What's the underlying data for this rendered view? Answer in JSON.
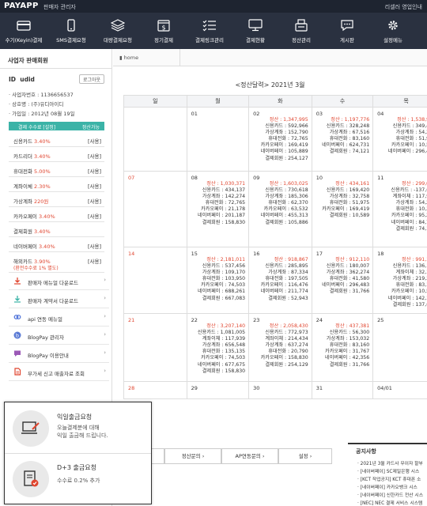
{
  "topbar": {
    "logo": "PAYAPP",
    "admin_label": "판매자 관리자",
    "right_link": "리셀러 영업인내"
  },
  "menu": [
    {
      "label": "수기(Keyin)결제",
      "icon": "card-icon"
    },
    {
      "label": "SMS결제요청",
      "icon": "sms-icon"
    },
    {
      "label": "대량결제요청",
      "icon": "layers-icon"
    },
    {
      "label": "정기결제",
      "icon": "calendar-dollar-icon"
    },
    {
      "label": "결제링크관리",
      "icon": "list-check-icon"
    },
    {
      "label": "결제현황",
      "icon": "monitor-icon"
    },
    {
      "label": "정산관리",
      "icon": "register-icon"
    },
    {
      "label": "게시판",
      "icon": "chat-icon"
    },
    {
      "label": "설정메뉴",
      "icon": "gear-icon"
    }
  ],
  "sidebar": {
    "title": "사업자 판매회원",
    "id_label": "ID",
    "id_value": "udid",
    "logout_label": "로그아웃",
    "biz_no": "· 사업자번호 : 1136656537",
    "company": "· 상호명 : (주)유디아이디",
    "joined": "· 가입일 : 2012년 08월 19일",
    "fee_header_left": "결제 수수료 [설정]",
    "fee_header_right": "정산가능",
    "fees": [
      {
        "name": "신용카드",
        "rate": "3.40%",
        "status": "[사용]"
      },
      {
        "name": "카드리더",
        "rate": "3.40%",
        "status": "[사용]"
      },
      {
        "name": "휴대전화",
        "rate": "5.00%",
        "status": "[사용]"
      },
      {
        "name": "계좌이체",
        "rate": "2.30%",
        "status": "[사용]"
      },
      {
        "name": "가상계좌",
        "rate": "220원",
        "status": "[사용]"
      },
      {
        "name": "카카오페이",
        "rate": "3.40%",
        "status": "[사용]"
      },
      {
        "name": "결제회원",
        "rate": "3.40%",
        "status": ""
      },
      {
        "name": "네이버페이",
        "rate": "3.40%",
        "status": "[사용]"
      },
      {
        "name": "해외카드",
        "rate": "3.90%",
        "status": "[사용]",
        "extra": "(환전수수료 1% 별도)"
      }
    ],
    "links": [
      {
        "label": "판매자 메뉴얼 다운로드",
        "icon": "download-icon"
      },
      {
        "label": "판매자 계약서 다운로드",
        "icon": "download-icon"
      },
      {
        "label": "api 연동 메뉴얼",
        "icon": "link-icon"
      },
      {
        "label": "BlogPay 관리자",
        "icon": "blog-icon"
      },
      {
        "label": "BlogPay 이용안내",
        "icon": "chat-icon"
      },
      {
        "label": "부가세 신고 매출자료 조회",
        "icon": "document-icon"
      }
    ]
  },
  "breadcrumb": "home",
  "calendar": {
    "title": "<정산달력> 2021년 3월",
    "weekdays": [
      "일",
      "월",
      "화",
      "수",
      "목"
    ],
    "rows": [
      [
        {
          "day": "",
          "lines": []
        },
        {
          "day": "01",
          "lines": []
        },
        {
          "day": "02",
          "lines": [
            "정산 : 1,347,995",
            "신용카드 : 592,966",
            "가상계좌 : 152,790",
            "휴대전화 : 72,765",
            "카카오페이 : 169,419",
            "네이버페이 : 105,889",
            "결제회원 : 254,127"
          ]
        },
        {
          "day": "03",
          "lines": [
            "정산 : 1,197,776",
            "신용카드 : 328,248",
            "가상계좌 : 67,516",
            "휴대전화 : 83,160",
            "네이버페이 : 624,731",
            "결제회원 : 74,121"
          ]
        },
        {
          "day": "04",
          "lines": [
            "정산 : 1,538,991",
            "신용카드 : 349,427",
            "가상계좌 : 54,274",
            "휴대전화 : 51,975",
            "카카오페이 : 10,589",
            "네이버페이 : 296,484"
          ]
        }
      ],
      [
        {
          "day": "07",
          "sunday": true,
          "lines": []
        },
        {
          "day": "08",
          "lines": [
            "정산 : 1,030,371",
            "신용카드 : 434,137",
            "가상계좌 : 142,274",
            "휴대전화 : 72,765",
            "카카오페이 : 21,178",
            "네이버페이 : 201,187",
            "결제회원 : 158,830"
          ]
        },
        {
          "day": "09",
          "lines": [
            "정산 : 1,603,025",
            "신용카드 : 730,618",
            "가상계좌 : 185,306",
            "휴대전화 : 62,370",
            "카카오페이 : 63,532",
            "네이버페이 : 455,313",
            "결제회원 : 105,886"
          ]
        },
        {
          "day": "10",
          "lines": [
            "정산 : 434,161",
            "신용카드 : 169,420",
            "가상계좌 : 32,758",
            "휴대전화 : 51,975",
            "카카오페이 : 169,419",
            "결제회원 : 10,589"
          ]
        },
        {
          "day": "11",
          "lines": [
            "정산 : 299,086",
            "신용카드 : -137,651",
            "계좌이체 : 117,939",
            "가상계좌 : 54,274",
            "휴대전화 : 10,395",
            "카카오페이 : 95,298",
            "네이버페이 : 84,710",
            "결제회원 : 74,121"
          ]
        }
      ],
      [
        {
          "day": "14",
          "sunday": true,
          "lines": []
        },
        {
          "day": "15",
          "lines": [
            "정산 : 2,181,011",
            "신용카드 : 537,456",
            "가상계좌 : 109,170",
            "휴대전화 : 103,950",
            "카카오페이 : 74,503",
            "네이버페이 : 688,261",
            "결제회원 : 667,083"
          ]
        },
        {
          "day": "16",
          "lines": [
            "정산 : 918,867",
            "신용카드 : 285,895",
            "가상계좌 : 87,334",
            "휴대전화 : 197,505",
            "카카오페이 : 116,476",
            "네이버페이 : 211,774",
            "결제회원 : 52,943"
          ]
        },
        {
          "day": "17",
          "lines": [
            "정산 : 912,110",
            "신용카드 : 180,007",
            "가상계좌 : 362,274",
            "휴대전화 : 41,580",
            "네이버페이 : 296,483",
            "결제회원 : 31,766"
          ]
        },
        {
          "day": "18",
          "lines": [
            "정산 : 991,100",
            "신용카드 : 136,178",
            "계좌이체 : 32,166",
            "가상계좌 : 219,274",
            "휴대전화 : 83,160",
            "카카오페이 : 10,589",
            "네이버페이 : 142,122",
            "결제회원 : 137,652"
          ]
        }
      ],
      [
        {
          "day": "21",
          "sunday": true,
          "lines": []
        },
        {
          "day": "22",
          "lines": [
            "정산 : 3,207,140",
            "신용카드 : 1,081,005",
            "계좌이체 : 117,939",
            "가상계좌 : 656,548",
            "휴대전화 : 135,135",
            "카카오페이 : 74,503",
            "네이버페이 : 677,675",
            "결제회원 : 158,830"
          ]
        },
        {
          "day": "23",
          "lines": [
            "정산 : 2,058,430",
            "신용카드 : 772,973",
            "계좌이체 : 214,434",
            "가상계좌 : 637,274",
            "휴대전화 : 20,790",
            "카카오페이 : 158,830",
            "결제회원 : 254,129"
          ]
        },
        {
          "day": "24",
          "lines": [
            "정산 : 437,381",
            "신용카드 : 56,300",
            "가상계좌 : 153,032",
            "휴대전화 : 83,160",
            "카카오페이 : 31,767",
            "네이버페이 : 42,356",
            "결제회원 : 31,766"
          ]
        },
        {
          "day": "25",
          "lines": []
        }
      ],
      [
        {
          "day": "28",
          "sunday": true,
          "lines": []
        },
        {
          "day": "29",
          "lines": []
        },
        {
          "day": "30",
          "lines": []
        },
        {
          "day": "31",
          "lines": []
        },
        {
          "day": "04/01",
          "lines": []
        }
      ]
    ]
  },
  "bottom_tabs": [
    "기",
    "정산문의",
    "AP연동문의",
    "설정"
  ],
  "bottom_tab_chevron": "›",
  "notice": {
    "title": "공지사항",
    "items": [
      "· 2021년 3월 카드사 무이자 할부",
      "· [네이버페이] SC제일은행 시스",
      "· [KCT 작업공지] KCT 휴대폰 소",
      "· [네이버페이] 카카오뱅크 시스",
      "· [네이버페이] 신한카드 전산 시스",
      "· [NEC] NEC 결제 서비스 시스템"
    ]
  },
  "popup": {
    "item1_title": "익일출금요청",
    "item1_sub1": "오늘결제분에 대해",
    "item1_sub2": "익일 출금해 드립니다.",
    "item2_title": "D+3 출금요청",
    "item2_sub": "수수료 0.2% 추가"
  },
  "colors": {
    "accent": "#3bb3a7",
    "negative": "#e0452f",
    "nav_bg": "#2a3140",
    "top_bg": "#1e2430"
  }
}
